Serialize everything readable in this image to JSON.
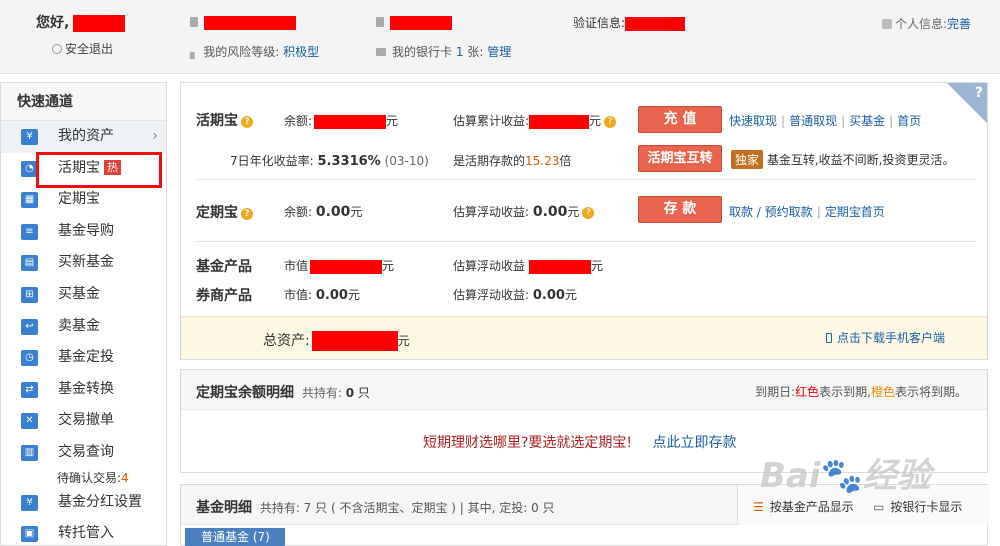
{
  "header": {
    "greeting": "您好,",
    "logout": "安全退出",
    "verify_label": "验证信息:",
    "personal_label": "个人信息:",
    "personal_link": "完善",
    "risk_label": "我的风险等级:",
    "risk_value": "积极型",
    "bank_label": "我的银行卡",
    "bank_count": "1",
    "bank_unit": "张:",
    "bank_manage": "管理"
  },
  "sidebar": {
    "title": "快速通道",
    "items": [
      {
        "label": "我的资产",
        "icon": "yen-icon"
      },
      {
        "label": "活期宝",
        "icon": "stopwatch-icon",
        "badge": "热"
      },
      {
        "label": "定期宝",
        "icon": "calendar-icon"
      },
      {
        "label": "基金导购",
        "icon": "guide-icon"
      },
      {
        "label": "买新基金",
        "icon": "doc-icon"
      },
      {
        "label": "买基金",
        "icon": "cart-icon"
      },
      {
        "label": "卖基金",
        "icon": "return-icon"
      },
      {
        "label": "基金定投",
        "icon": "clock-icon"
      },
      {
        "label": "基金转换",
        "icon": "swap-icon"
      },
      {
        "label": "交易撤单",
        "icon": "cancel-icon"
      },
      {
        "label": "交易查询",
        "icon": "search-doc-icon"
      },
      {
        "label": "基金分红设置",
        "icon": "money-bag-icon"
      },
      {
        "label": "转托管入",
        "icon": "transfer-icon"
      }
    ],
    "pending_label": "待确认交易:",
    "pending_count": "4"
  },
  "main": {
    "huoqi": {
      "name": "活期宝",
      "balance_label": "余额:",
      "balance_unit": "元",
      "est_label": "估算累计收益:",
      "est_unit": "元",
      "rate_label": "7日年化收益率:",
      "rate_value": "5.3316%",
      "rate_date": "(03-10)",
      "multiple_prefix": "是活期存款的",
      "multiple_value": "15.23",
      "multiple_suffix": "倍",
      "btn_recharge": "充 值",
      "btn_swap": "活期宝互转",
      "links": [
        "快速取现",
        "普通取现",
        "买基金",
        "首页"
      ],
      "exclusive": "独家",
      "swap_desc": "基金互转,收益不间断,投资更灵活。"
    },
    "dingqi": {
      "name": "定期宝",
      "balance_label": "余额:",
      "balance_value": "0.00",
      "balance_unit": "元",
      "est_label": "估算浮动收益:",
      "est_value": "0.00",
      "est_unit": "元",
      "btn_deposit": "存 款",
      "link1": "取款 / 预约取款",
      "link2": "定期宝首页"
    },
    "fund": {
      "name": "基金产品",
      "mv_label": "市值",
      "mv_unit": "元",
      "est_label": "估算浮动收益",
      "est_unit": "元"
    },
    "broker": {
      "name": "券商产品",
      "mv_label": "市值:",
      "mv_value": "0.00",
      "mv_unit": "元",
      "est_label": "估算浮动收益:",
      "est_value": "0.00",
      "est_unit": "元"
    },
    "total_label": "总资产:",
    "total_unit": "元",
    "download": "点击下载手机客户端"
  },
  "dingqi_detail": {
    "title": "定期宝余额明细",
    "hold_label": "共持有:",
    "hold_count": "0",
    "hold_unit": "只",
    "legend_prefix": "到期日:",
    "legend_red": "红色",
    "legend_red_text": "表示到期,",
    "legend_orange": "橙色",
    "legend_orange_text": "表示将到期。",
    "promo": "短期理财选哪里?要选就选定期宝!",
    "promo_link": "点此立即存款"
  },
  "fund_detail": {
    "title": "基金明细",
    "summary": "共持有: 7 只 ( 不含活期宝、定期宝 ) | 其中, 定投: 0 只",
    "by_product": "按基金产品显示",
    "by_bank": "按银行卡显示",
    "tab": "普通基金 (7)"
  },
  "watermark": "Baidu 经验",
  "colors": {
    "accent_blue": "#1a5fa6",
    "orange_button": "#e8644f",
    "highlight_red": "#ee1010"
  }
}
